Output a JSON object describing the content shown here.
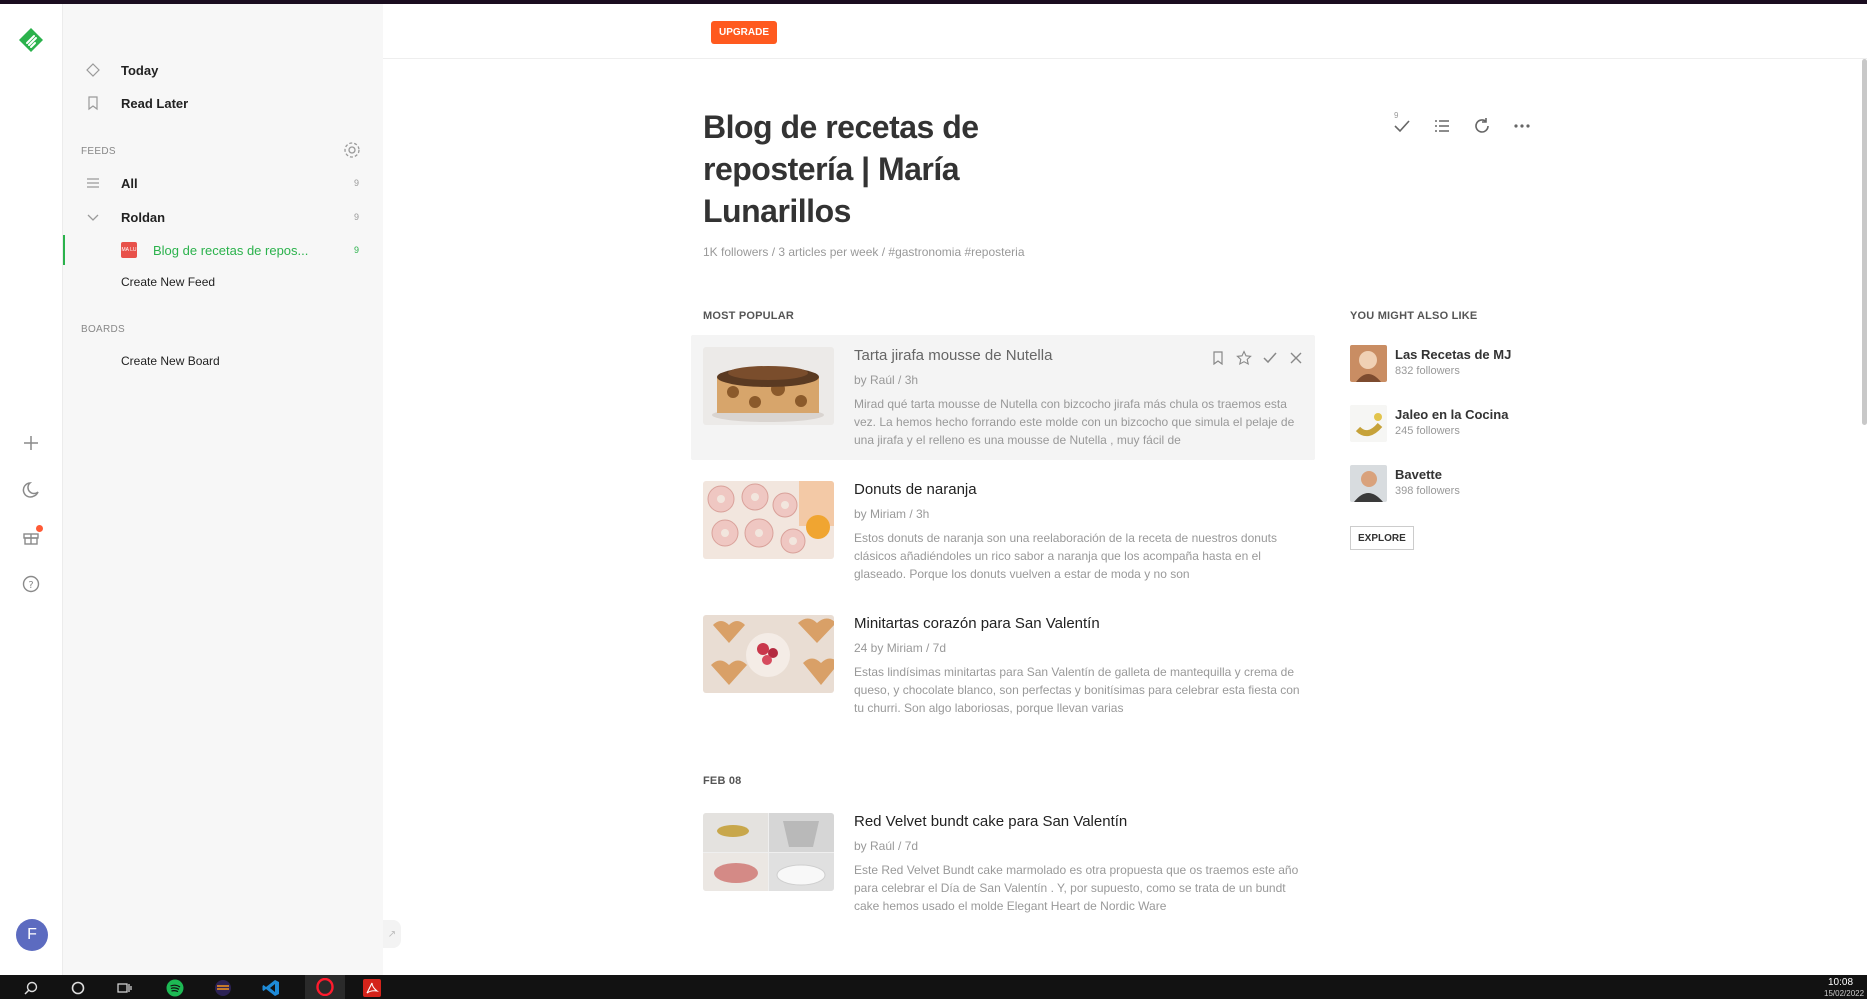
{
  "app": {
    "upgrade_label": "UPGRADE",
    "accent_color": "#2bb24c",
    "upgrade_color": "#ff5a1f"
  },
  "rail": {
    "icons": [
      "feedly-logo-icon",
      "plus-icon",
      "moon-icon",
      "gift-icon",
      "help-icon"
    ],
    "avatar_letter": "F"
  },
  "sidebar": {
    "today": "Today",
    "read_later": "Read Later",
    "feeds_label": "FEEDS",
    "all": {
      "label": "All",
      "count": "9"
    },
    "group": {
      "label": "Roldan",
      "count": "9"
    },
    "feed": {
      "label": "Blog de recetas de repos...",
      "count": "9",
      "favicon_text": "MA LU"
    },
    "create_feed": "Create New Feed",
    "boards_label": "BOARDS",
    "create_board": "Create New Board"
  },
  "main": {
    "title": "Blog de recetas de repostería | María Lunarillos",
    "subtitle": "1K followers / 3 articles per week / #gastronomia  #reposteria",
    "mark_read_count": "9",
    "most_popular_label": "MOST POPULAR",
    "date_label": "FEB 08",
    "articles": [
      {
        "title": "Tarta jirafa mousse de Nutella",
        "meta": "by Raúl / 3h",
        "summary": "Mirad qué tarta mousse de Nutella con bizcocho jirafa más chula os traemos esta vez. La hemos hecho forrando este molde con un bizcocho que simula el pelaje de una jirafa y el relleno es una mousse de Nutella , muy fácil de"
      },
      {
        "title": "Donuts de naranja",
        "meta": "by Miriam / 3h",
        "summary": "Estos donuts de naranja son una reelaboración de la receta de nuestros donuts clásicos añadiéndoles un rico sabor a naranja que los acompaña hasta en el glaseado. Porque los donuts vuelven a estar de moda y no son"
      },
      {
        "title": "Minitartas corazón para San Valentín",
        "meta": "24   by Miriam / 7d",
        "summary": "Estas lindísimas minitartas para San Valentín de galleta de mantequilla y crema de queso, y chocolate blanco, son perfectas y bonitísimas para celebrar esta fiesta con tu churri. Son algo laboriosas, porque llevan varias"
      },
      {
        "title": "Red Velvet bundt cake para San Valentín",
        "meta": "by Raúl / 7d",
        "summary": "Este Red Velvet Bundt cake marmolado es otra propuesta que os traemos este año para celebrar el Día de San Valentín . Y, por supuesto, como se trata de un bundt cake hemos usado el molde Elegant Heart de Nordic Ware"
      }
    ]
  },
  "right": {
    "heading": "YOU MIGHT ALSO LIKE",
    "recommendations": [
      {
        "name": "Las Recetas de MJ",
        "followers": "832 followers"
      },
      {
        "name": "Jaleo en la Cocina",
        "followers": "245 followers"
      },
      {
        "name": "Bavette",
        "followers": "398 followers"
      }
    ],
    "explore_label": "EXPLORE"
  },
  "taskbar": {
    "time": "10:08",
    "date": "15/02/2022"
  }
}
